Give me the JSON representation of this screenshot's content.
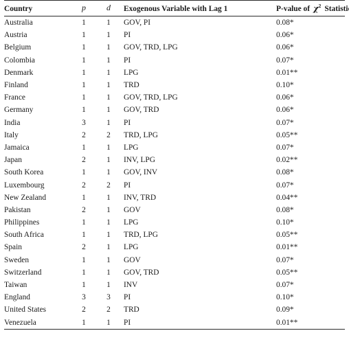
{
  "table": {
    "headers": {
      "country": "Country",
      "p": "p",
      "d": "d",
      "exogenous": "Exogenous Variable with Lag 1",
      "pvalue_prefix": "P-value of",
      "pvalue_symbol": "χ",
      "pvalue_exponent": "2",
      "pvalue_suffix": "Statistic"
    },
    "rows": [
      {
        "country": "Australia",
        "p": "1",
        "d": "1",
        "exogenous": "GOV, PI",
        "pvalue": "0.08*"
      },
      {
        "country": "Austria",
        "p": "1",
        "d": "1",
        "exogenous": "PI",
        "pvalue": "0.06*"
      },
      {
        "country": "Belgium",
        "p": "1",
        "d": "1",
        "exogenous": "GOV, TRD, LPG",
        "pvalue": "0.06*"
      },
      {
        "country": "Colombia",
        "p": "1",
        "d": "1",
        "exogenous": "PI",
        "pvalue": "0.07*"
      },
      {
        "country": "Denmark",
        "p": "1",
        "d": "1",
        "exogenous": "LPG",
        "pvalue": "0.01**"
      },
      {
        "country": "Finland",
        "p": "1",
        "d": "1",
        "exogenous": "TRD",
        "pvalue": "0.10*"
      },
      {
        "country": "France",
        "p": "1",
        "d": "1",
        "exogenous": "GOV, TRD, LPG",
        "pvalue": "0.06*"
      },
      {
        "country": "Germany",
        "p": "1",
        "d": "1",
        "exogenous": "GOV, TRD",
        "pvalue": "0.06*"
      },
      {
        "country": "India",
        "p": "3",
        "d": "1",
        "exogenous": "PI",
        "pvalue": "0.07*"
      },
      {
        "country": "Italy",
        "p": "2",
        "d": "2",
        "exogenous": "TRD, LPG",
        "pvalue": "0.05**"
      },
      {
        "country": "Jamaica",
        "p": "1",
        "d": "1",
        "exogenous": "LPG",
        "pvalue": "0.07*"
      },
      {
        "country": "Japan",
        "p": "2",
        "d": "1",
        "exogenous": "INV, LPG",
        "pvalue": "0.02**"
      },
      {
        "country": "South Korea",
        "p": "1",
        "d": "1",
        "exogenous": "GOV, INV",
        "pvalue": "0.08*"
      },
      {
        "country": "Luxembourg",
        "p": "2",
        "d": "2",
        "exogenous": "PI",
        "pvalue": "0.07*"
      },
      {
        "country": "New Zealand",
        "p": "1",
        "d": "1",
        "exogenous": "INV, TRD",
        "pvalue": "0.04**"
      },
      {
        "country": "Pakistan",
        "p": "2",
        "d": "1",
        "exogenous": "GOV",
        "pvalue": "0.08*"
      },
      {
        "country": "Philippines",
        "p": "1",
        "d": "1",
        "exogenous": "LPG",
        "pvalue": "0.10*"
      },
      {
        "country": "South Africa",
        "p": "1",
        "d": "1",
        "exogenous": "TRD, LPG",
        "pvalue": "0.05**"
      },
      {
        "country": "Spain",
        "p": "2",
        "d": "1",
        "exogenous": "LPG",
        "pvalue": "0.01**"
      },
      {
        "country": "Sweden",
        "p": "1",
        "d": "1",
        "exogenous": "GOV",
        "pvalue": "0.07*"
      },
      {
        "country": "Switzerland",
        "p": "1",
        "d": "1",
        "exogenous": "GOV, TRD",
        "pvalue": "0.05**"
      },
      {
        "country": "Taiwan",
        "p": "1",
        "d": "1",
        "exogenous": "INV",
        "pvalue": "0.07*"
      },
      {
        "country": "England",
        "p": "3",
        "d": "3",
        "exogenous": "PI",
        "pvalue": "0.10*"
      },
      {
        "country": "United States",
        "p": "2",
        "d": "2",
        "exogenous": "TRD",
        "pvalue": "0.09*"
      },
      {
        "country": "Venezuela",
        "p": "1",
        "d": "1",
        "exogenous": "PI",
        "pvalue": "0.01**"
      }
    ]
  }
}
